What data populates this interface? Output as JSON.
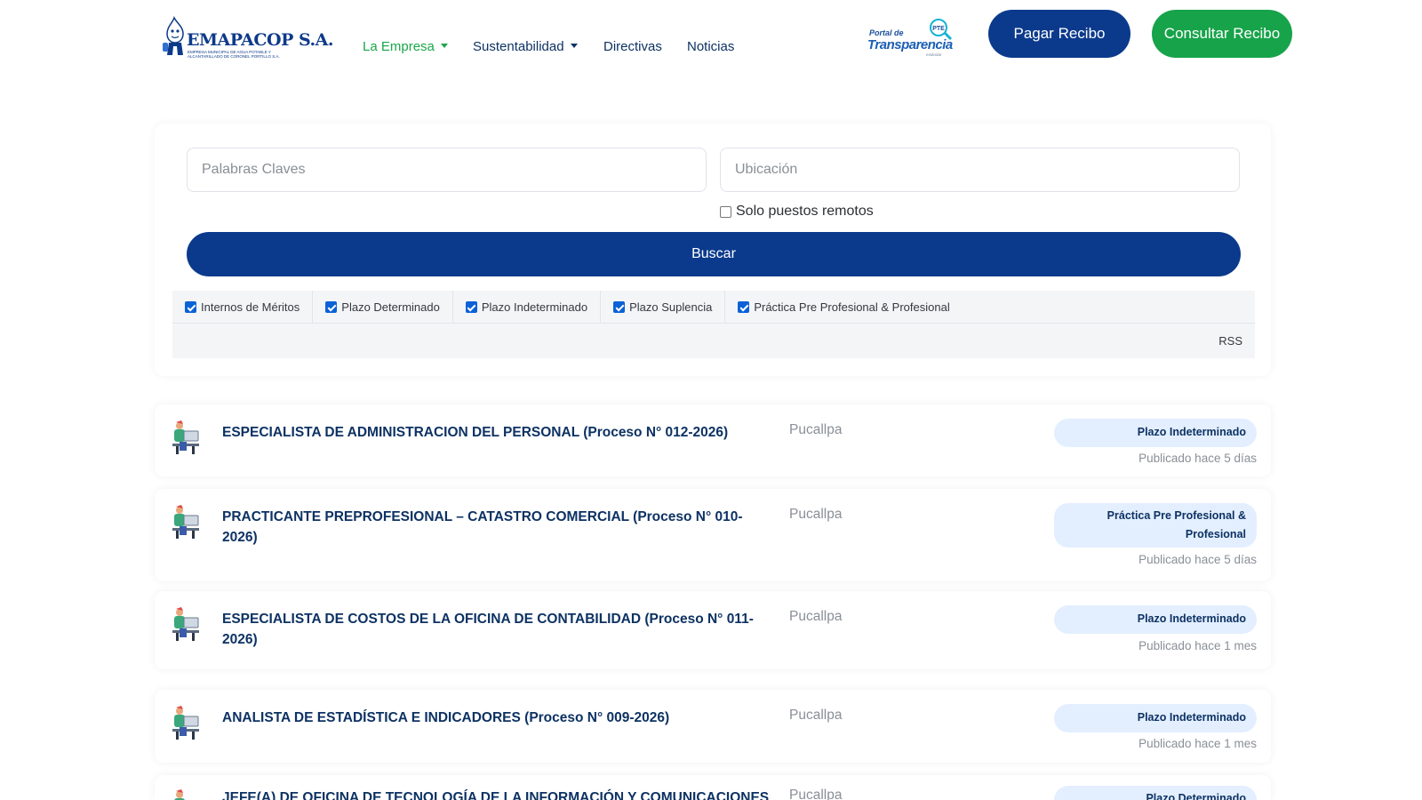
{
  "header": {
    "logo_text": "EMAPACOP S.A.",
    "logo_subtitle": "EMPRESA MUNICIPAL DE AGUA POTABLE Y ALCANTARILLADO DE CORONEL PORTILLO S.A.",
    "nav": [
      {
        "label": "La Empresa",
        "dropdown": true,
        "active": true
      },
      {
        "label": "Sustentabilidad",
        "dropdown": true,
        "active": false
      },
      {
        "label": "Directivas",
        "dropdown": false,
        "active": false
      },
      {
        "label": "Noticias",
        "dropdown": false,
        "active": false
      }
    ],
    "transparency": {
      "line1": "Portal de",
      "line2": "Transparencia",
      "badge": "PTE",
      "tiny": "estándar"
    },
    "pay_button": "Pagar Recibo",
    "consult_button": "Consultar Recibo"
  },
  "search": {
    "keywords_placeholder": "Palabras Claves",
    "location_placeholder": "Ubicación",
    "remote_label": "Solo puestos remotos",
    "remote_checked": false,
    "search_button": "Buscar",
    "filters": [
      {
        "label": "Internos de Méritos",
        "checked": true
      },
      {
        "label": "Plazo Determinado",
        "checked": true
      },
      {
        "label": "Plazo Indeterminado",
        "checked": true
      },
      {
        "label": "Plazo Suplencia",
        "checked": true
      },
      {
        "label": "Práctica Pre Profesional & Profesional",
        "checked": true
      }
    ],
    "rss_label": "RSS"
  },
  "jobs": [
    {
      "title": "ESPECIALISTA DE ADMINISTRACION DEL PERSONAL (Proceso N° 012-2026)",
      "location": "Pucallpa",
      "type": "Plazo Indeterminado",
      "posted": "Publicado hace 5 días"
    },
    {
      "title": "PRACTICANTE PREPROFESIONAL – CATASTRO COMERCIAL (Proceso N° 010-2026)",
      "location": "Pucallpa",
      "type": "Práctica Pre Profesional & Profesional",
      "posted": "Publicado hace 5 días"
    },
    {
      "title": "ESPECIALISTA DE COSTOS DE LA OFICINA DE CONTABILIDAD (Proceso N° 011-2026)",
      "location": "Pucallpa",
      "type": "Plazo Indeterminado",
      "posted": "Publicado hace 1 mes"
    },
    {
      "title": "ANALISTA DE ESTADÍSTICA E INDICADORES (Proceso N° 009-2026)",
      "location": "Pucallpa",
      "type": "Plazo Indeterminado",
      "posted": "Publicado hace 1 mes"
    },
    {
      "title": "JEFE(A) DE OFICINA DE TECNOLOGÍA DE LA INFORMACIÓN Y COMUNICACIONES",
      "location": "Pucallpa",
      "type": "Plazo Determinado",
      "posted": ""
    }
  ],
  "colors": {
    "primary": "#0b3a8c",
    "accent": "#17a34a",
    "badge_bg": "#e3efff"
  }
}
